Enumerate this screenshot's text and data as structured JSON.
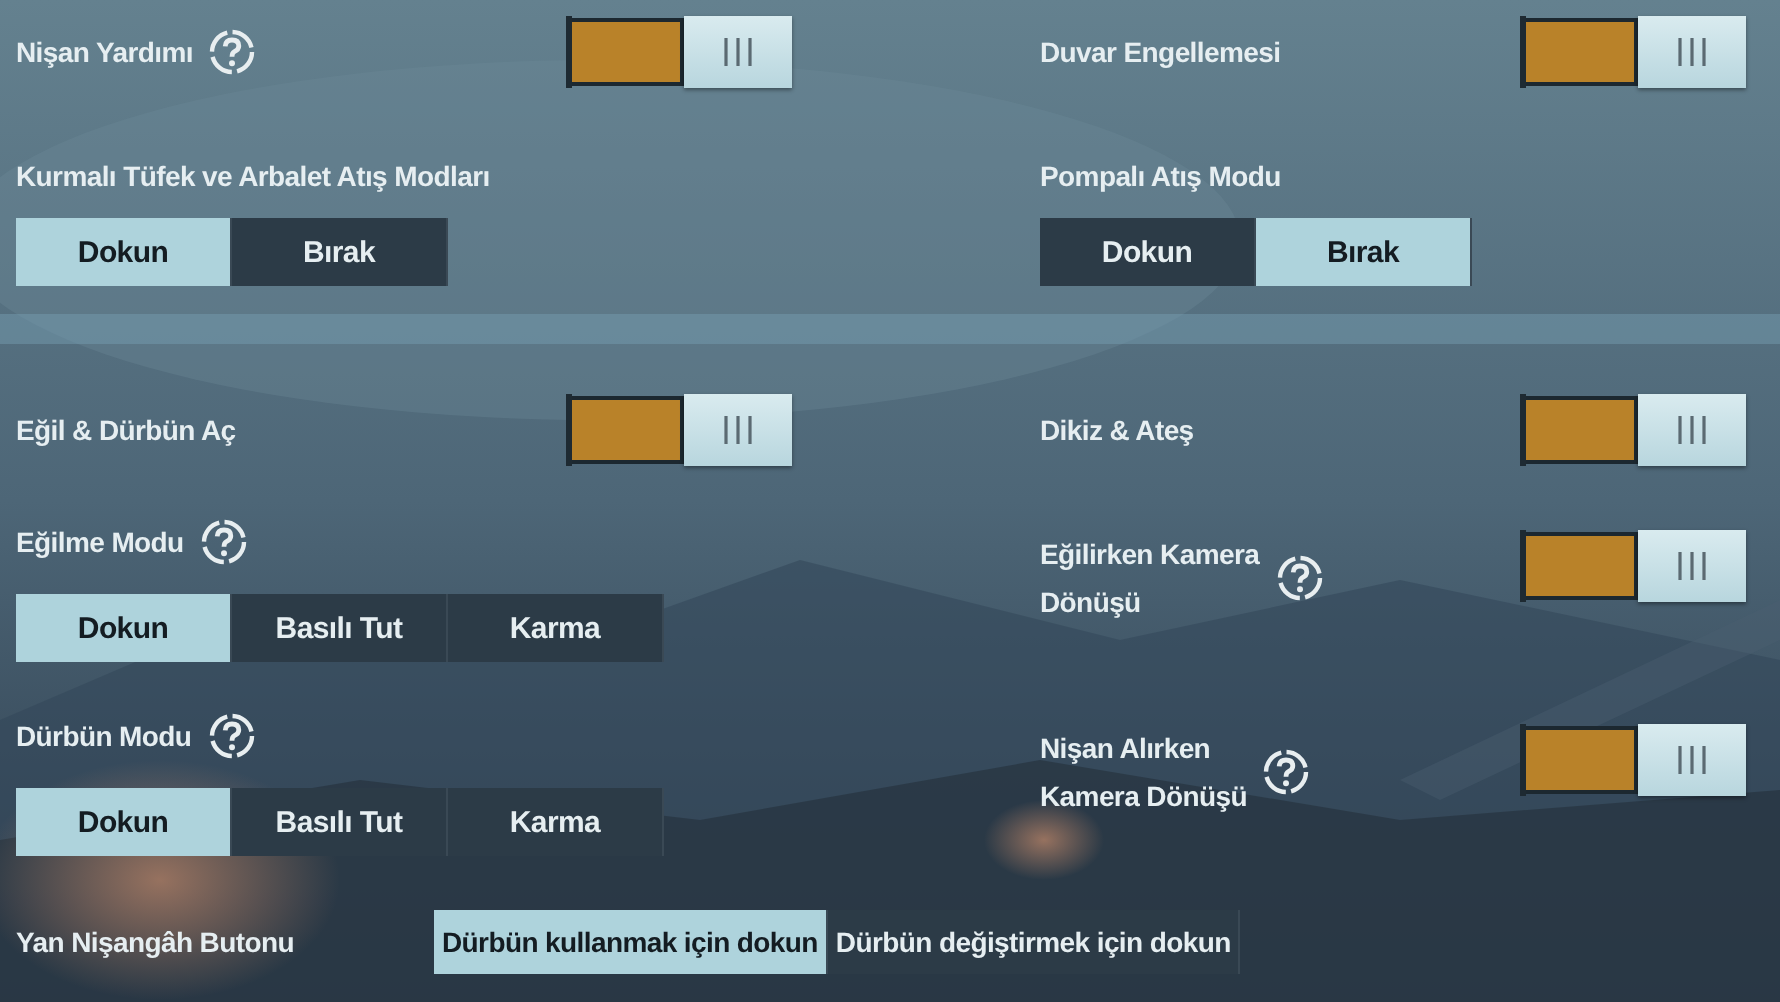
{
  "sections": [
    {
      "rows": [
        {
          "left": {
            "kind": "toggle",
            "label": [
              "Nişan Yardımı"
            ],
            "help": true,
            "on": true
          },
          "right": {
            "kind": "toggle",
            "label": [
              "Duvar Engellemesi"
            ],
            "on": true
          }
        },
        {
          "left": {
            "kind": "segmented",
            "label": "Kurmalı Tüfek ve Arbalet Atış Modları",
            "options": [
              {
                "label": "Dokun",
                "selected": true
              },
              {
                "label": "Bırak",
                "selected": false
              }
            ]
          },
          "right": {
            "kind": "segmented",
            "label": "Pompalı Atış Modu",
            "options": [
              {
                "label": "Dokun",
                "selected": false
              },
              {
                "label": "Bırak",
                "selected": true
              }
            ]
          }
        }
      ]
    },
    {
      "rows": [
        {
          "left": {
            "kind": "toggle",
            "label": [
              "Eğil & Dürbün Aç"
            ],
            "on": true
          },
          "right": {
            "kind": "toggle",
            "label": [
              "Dikiz & Ateş"
            ],
            "on": true
          }
        },
        {
          "left": {
            "kind": "segmented",
            "label": "Eğilme Modu",
            "help": true,
            "options": [
              {
                "label": "Dokun",
                "selected": true
              },
              {
                "label": "Basılı Tut",
                "selected": false
              },
              {
                "label": "Karma",
                "selected": false
              }
            ]
          },
          "right": {
            "kind": "toggle",
            "label": [
              "Eğilirken Kamera",
              "Dönüşü"
            ],
            "help": true,
            "on": true
          }
        },
        {
          "left": {
            "kind": "segmented",
            "label": "Dürbün Modu",
            "help": true,
            "options": [
              {
                "label": "Dokun",
                "selected": true
              },
              {
                "label": "Basılı Tut",
                "selected": false
              },
              {
                "label": "Karma",
                "selected": false
              }
            ]
          },
          "right": {
            "kind": "toggle",
            "label": [
              "Nişan Alırken",
              "Kamera Dönüşü"
            ],
            "help": true,
            "on": true
          }
        },
        {
          "full": {
            "kind": "options",
            "label": "Yan Nişangâh Butonu",
            "options": [
              {
                "label": "Dürbün kullanmak için dokun",
                "selected": true
              },
              {
                "label": "Dürbün değiştirmek için dokun",
                "selected": false
              }
            ]
          }
        }
      ]
    }
  ]
}
